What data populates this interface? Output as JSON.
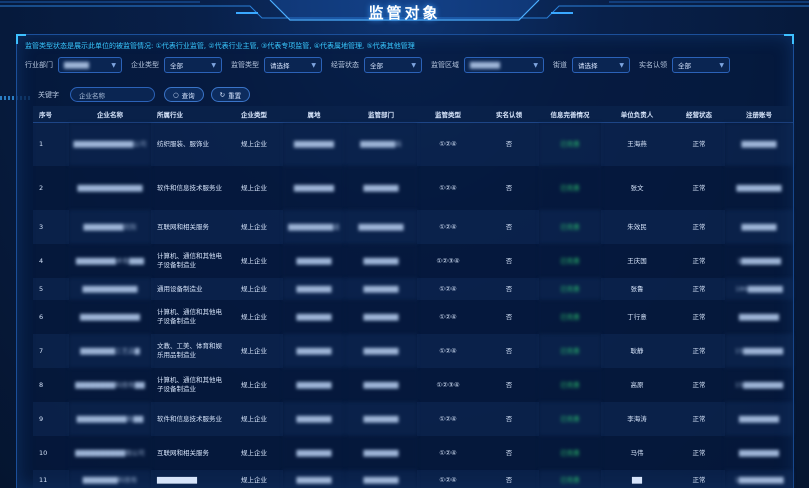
{
  "title": "监管对象",
  "legend": "监管类型状态是展示此单位的被监管情况: ①代表行业监管, ②代表行业主管, ③代表专项监管, ④代表属地管理, ⑤代表其他管理",
  "filters": {
    "industry_dept": {
      "label": "行业部门",
      "value": "▇▇▇▇▇"
    },
    "company_type": {
      "label": "企业类型",
      "value": "全部"
    },
    "supervise_type": {
      "label": "监管类型",
      "value": "请选择"
    },
    "status": {
      "label": "经营状态",
      "value": "全部"
    },
    "region": {
      "label": "监管区域",
      "value": "▇▇▇▇▇▇"
    },
    "street": {
      "label": "街道",
      "value": "请选择"
    },
    "realname": {
      "label": "实名认领",
      "value": "全部"
    }
  },
  "search": {
    "label": "关键字",
    "placeholder": "企业名称",
    "query_btn": "查询",
    "reset_btn": "重置"
  },
  "columns": [
    "序号",
    "企业名称",
    "所属行业",
    "企业类型",
    "属地",
    "监管部门",
    "监管类型",
    "实名认领",
    "信息完善情况",
    "单位负责人",
    "经营状态",
    "注册账号"
  ],
  "rows": [
    {
      "no": "1",
      "name": "▇▇▇▇▇▇▇▇▇▇▇▇公司",
      "industry": "纺织服装、服饰业",
      "type": "规上企业",
      "place": "▇▇▇▇▇▇▇▇",
      "dept": "▇▇▇▇▇▇▇局",
      "stype": "①②④",
      "realname": "否",
      "info": "已完善",
      "leader": "王海燕",
      "state": "正常",
      "account": "▇▇▇▇▇▇▇"
    },
    {
      "no": "2",
      "name": "▇▇▇▇▇▇▇▇▇▇▇▇▇",
      "industry": "软件和信息技术服务业",
      "type": "规上企业",
      "place": "▇▇▇▇▇▇▇▇",
      "dept": "▇▇▇▇▇▇▇",
      "stype": "①②④",
      "realname": "否",
      "info": "已完善",
      "leader": "张文",
      "state": "正常",
      "account": "▇▇▇▇▇▇▇▇▇"
    },
    {
      "no": "3",
      "name": "▇▇▇▇▇▇▇▇究院",
      "industry": "互联网和相关服务",
      "type": "规上企业",
      "place": "▇▇▇▇▇▇▇▇▇道",
      "dept": "▇▇▇▇▇▇▇▇▇",
      "stype": "①②④",
      "realname": "否",
      "info": "已完善",
      "leader": "朱效民",
      "state": "正常",
      "account": "▇▇▇▇▇▇▇"
    },
    {
      "no": "4",
      "name": "▇▇▇▇▇▇▇▇术有▇▇▇",
      "industry": "计算机、通信和其他电子设备制造业",
      "type": "规上企业",
      "place": "▇▇▇▇▇▇▇",
      "dept": "▇▇▇▇▇▇▇",
      "stype": "①②③④",
      "realname": "否",
      "info": "已完善",
      "leader": "王庆国",
      "state": "正常",
      "account": "1▇▇▇▇▇▇▇▇"
    },
    {
      "no": "5",
      "name": "▇▇▇▇▇▇▇▇▇▇▇",
      "industry": "通用设备制造业",
      "type": "规上企业",
      "place": "▇▇▇▇▇▇▇",
      "dept": "▇▇▇▇▇▇▇",
      "stype": "①②④",
      "realname": "否",
      "info": "已完善",
      "leader": "张鲁",
      "state": "正常",
      "account": "186▇▇▇▇▇▇▇"
    },
    {
      "no": "6",
      "name": "▇▇▇▇▇▇▇▇▇▇▇▇",
      "industry": "计算机、通信和其他电子设备制造业",
      "type": "规上企业",
      "place": "▇▇▇▇▇▇▇",
      "dept": "▇▇▇▇▇▇▇",
      "stype": "①②④",
      "realname": "否",
      "info": "已完善",
      "leader": "丁行意",
      "state": "正常",
      "account": "▇▇▇▇▇▇▇▇"
    },
    {
      "no": "7",
      "name": "▇▇▇▇▇▇▇工艺品▇",
      "industry": "文教、工美、体育和娱乐用品制造业",
      "type": "规上企业",
      "place": "▇▇▇▇▇▇▇",
      "dept": "▇▇▇▇▇▇▇",
      "stype": "①②④",
      "realname": "否",
      "info": "已完善",
      "leader": "耿静",
      "state": "正常",
      "account": "15▇▇▇▇▇▇▇▇"
    },
    {
      "no": "8",
      "name": "▇▇▇▇▇▇▇▇科技有▇▇",
      "industry": "计算机、通信和其他电子设备制造业",
      "type": "规上企业",
      "place": "▇▇▇▇▇▇▇",
      "dept": "▇▇▇▇▇▇▇",
      "stype": "①②③④",
      "realname": "否",
      "info": "已完善",
      "leader": "高原",
      "state": "正常",
      "account": "15▇▇▇▇▇▇▇▇"
    },
    {
      "no": "9",
      "name": "▇▇▇▇▇▇▇▇▇▇有▇▇",
      "industry": "软件和信息技术服务业",
      "type": "规上企业",
      "place": "▇▇▇▇▇▇▇",
      "dept": "▇▇▇▇▇▇▇",
      "stype": "①②④",
      "realname": "否",
      "info": "已完善",
      "leader": "李海涛",
      "state": "正常",
      "account": "▇▇▇▇▇▇▇▇"
    },
    {
      "no": "10",
      "name": "▇▇▇▇▇▇▇▇▇▇限公司",
      "industry": "互联网和相关服务",
      "type": "规上企业",
      "place": "▇▇▇▇▇▇▇",
      "dept": "▇▇▇▇▇▇▇",
      "stype": "①②④",
      "realname": "否",
      "info": "已完善",
      "leader": "马伟",
      "state": "正常",
      "account": "▇▇▇▇▇▇▇▇"
    },
    {
      "no": "11",
      "name": "▇▇▇▇▇▇▇科技有",
      "industry": "▇▇▇▇▇▇▇▇",
      "type": "规上企业",
      "place": "▇▇▇▇▇▇▇",
      "dept": "▇▇▇▇▇▇▇",
      "stype": "①②④",
      "realname": "否",
      "info": "已完善",
      "leader": "▇▇",
      "state": "正常",
      "account": "1▇▇▇▇▇▇▇▇▇"
    }
  ]
}
